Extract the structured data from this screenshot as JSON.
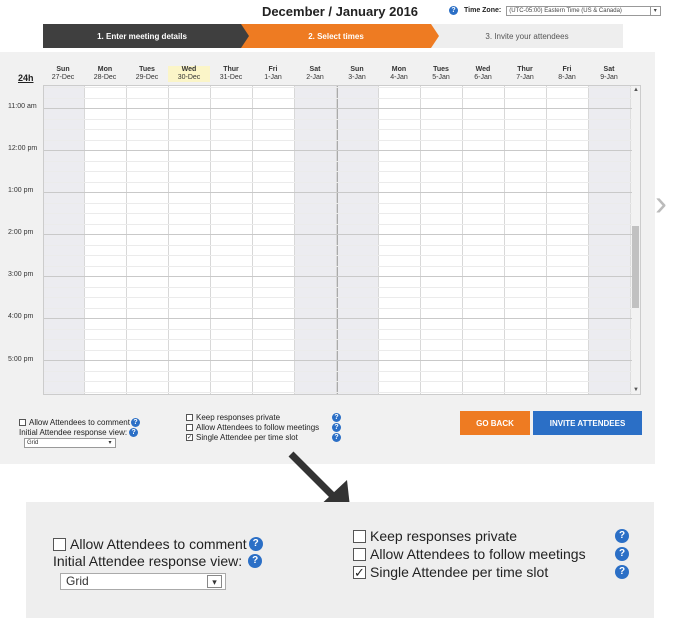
{
  "header": {
    "title": "December / January 2016"
  },
  "timezone": {
    "label": "Time Zone:",
    "value": "(UTC-05:00) Eastern Time (US & Canada)"
  },
  "steps": [
    {
      "label": "1. Enter meeting details",
      "state": "done"
    },
    {
      "label": "2. Select times",
      "state": "active"
    },
    {
      "label": "3. Invite your attendees",
      "state": "pending"
    }
  ],
  "calendar": {
    "format_label": "24h",
    "days": [
      {
        "name": "Sun",
        "date": "27-Dec",
        "weekend": true
      },
      {
        "name": "Mon",
        "date": "28-Dec"
      },
      {
        "name": "Tues",
        "date": "29-Dec"
      },
      {
        "name": "Wed",
        "date": "30-Dec",
        "today": true
      },
      {
        "name": "Thur",
        "date": "31-Dec"
      },
      {
        "name": "Fri",
        "date": "1-Jan"
      },
      {
        "name": "Sat",
        "date": "2-Jan",
        "weekend": true
      },
      {
        "name": "Sun",
        "date": "3-Jan",
        "weekend": true
      },
      {
        "name": "Mon",
        "date": "4-Jan"
      },
      {
        "name": "Tues",
        "date": "5-Jan"
      },
      {
        "name": "Wed",
        "date": "6-Jan"
      },
      {
        "name": "Thur",
        "date": "7-Jan"
      },
      {
        "name": "Fri",
        "date": "8-Jan"
      },
      {
        "name": "Sat",
        "date": "9-Jan",
        "weekend": true
      }
    ],
    "times": [
      "11:00 am",
      "12:00 pm",
      "1:00 pm",
      "2:00 pm",
      "3:00 pm",
      "4:00 pm",
      "5:00 pm"
    ]
  },
  "options": {
    "allow_comment": {
      "label": "Allow Attendees to comment",
      "checked": false
    },
    "response_view": {
      "label": "Initial Attendee response view:",
      "value": "Grid"
    },
    "keep_private": {
      "label": "Keep responses private",
      "checked": false
    },
    "allow_follow": {
      "label": "Allow Attendees to follow meetings",
      "checked": false
    },
    "single_attendee": {
      "label": "Single Attendee per time slot",
      "checked": true
    }
  },
  "buttons": {
    "go_back": "GO BACK",
    "invite": "INVITE ATTENDEES"
  },
  "icons": {
    "help": "?",
    "check": "✓",
    "dropdown": "▾",
    "next": "›"
  },
  "colors": {
    "accent_orange": "#ee7b22",
    "accent_blue": "#2b6fc6",
    "step_dark": "#3f3f3f"
  }
}
